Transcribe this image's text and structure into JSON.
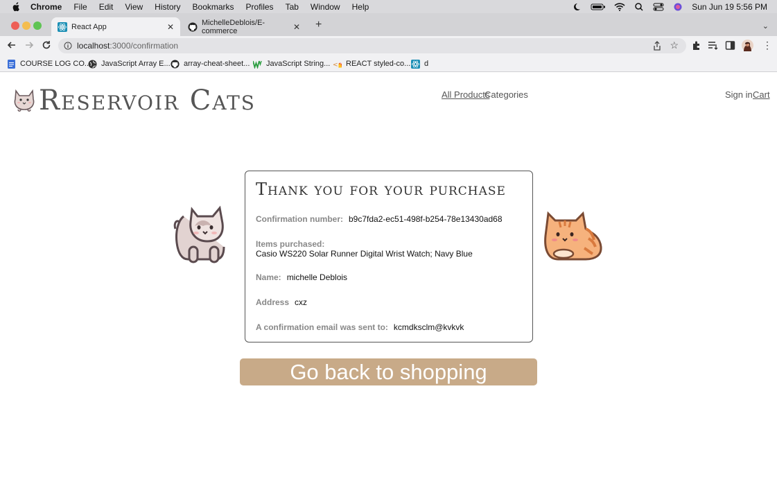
{
  "menubar": {
    "items": [
      "Chrome",
      "File",
      "Edit",
      "View",
      "History",
      "Bookmarks",
      "Profiles",
      "Tab",
      "Window",
      "Help"
    ],
    "datetime": "Sun Jun 19  5:56 PM"
  },
  "tabs": [
    {
      "label": "React App",
      "favicon": "react-icon",
      "active": true
    },
    {
      "label": "MichelleDeblois/E-commerce",
      "favicon": "github-icon",
      "active": false
    }
  ],
  "address": {
    "host": "localhost",
    "path": ":3000/confirmation"
  },
  "bookmarks": [
    {
      "label": "COURSE LOG CO...",
      "icon": "doc-icon"
    },
    {
      "label": "JavaScript Array E...",
      "icon": "globe-icon"
    },
    {
      "label": "array-cheat-sheet...",
      "icon": "github-icon"
    },
    {
      "label": "JavaScript String...",
      "icon": "w3-icon"
    },
    {
      "label": "REACT styled-co...",
      "icon": "styled-icon"
    },
    {
      "label": "d",
      "icon": "react-icon"
    }
  ],
  "site": {
    "title": "Reservoir Cats",
    "nav": {
      "all_products": "All Products",
      "categories": "Categories",
      "sign_in": "Sign in",
      "cart": "Cart"
    }
  },
  "confirmation": {
    "heading": "Thank you for your purchase",
    "number_label": "Confirmation number:",
    "number_value": "b9c7fda2-ec51-498f-b254-78e13430ad68",
    "items_label": "Items purchased:",
    "items_value": "Casio WS220 Solar Runner Digital Wrist Watch; Navy Blue",
    "name_label": "Name:",
    "name_value": "michelle Deblois",
    "address_label": "Address",
    "address_value": "cxz",
    "email_label": "A confirmation email was sent to:",
    "email_value": "kcmdksclm@kvkvk"
  },
  "back_button": "Go back to shopping",
  "colors": {
    "button": "#c8aa88",
    "text_muted": "#888888"
  }
}
